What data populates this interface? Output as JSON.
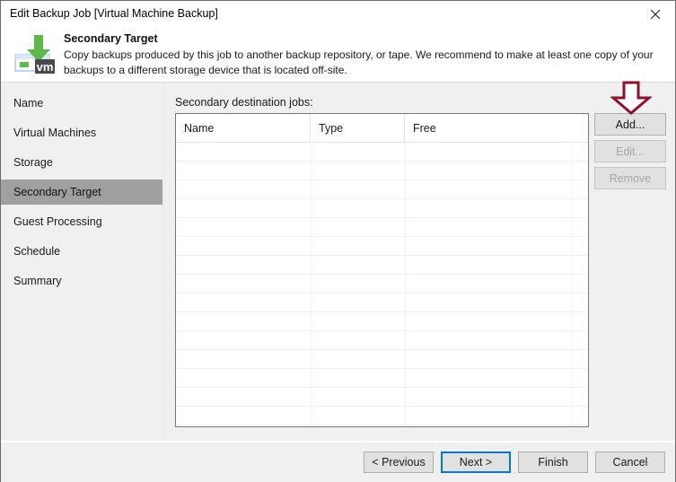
{
  "window": {
    "title": "Edit Backup Job [Virtual Machine Backup]",
    "close_icon": "close-icon"
  },
  "header": {
    "icon": "vm-backup-download-icon",
    "title": "Secondary Target",
    "description": "Copy backups produced by this job to another backup repository, or tape. We recommend to make at least one copy of your backups to a different storage device that is located off-site."
  },
  "sidebar": {
    "items": [
      {
        "label": "Name",
        "selected": false
      },
      {
        "label": "Virtual Machines",
        "selected": false
      },
      {
        "label": "Storage",
        "selected": false
      },
      {
        "label": "Secondary Target",
        "selected": true
      },
      {
        "label": "Guest Processing",
        "selected": false
      },
      {
        "label": "Schedule",
        "selected": false
      },
      {
        "label": "Summary",
        "selected": false
      }
    ]
  },
  "main": {
    "grid_label": "Secondary destination jobs:",
    "grid": {
      "columns": [
        "Name",
        "Type",
        "Free"
      ],
      "rows": []
    },
    "side_buttons": [
      {
        "label": "Add...",
        "enabled": true
      },
      {
        "label": "Edit...",
        "enabled": false
      },
      {
        "label": "Remove",
        "enabled": false
      }
    ]
  },
  "annotation": {
    "arrow": "down-arrow-annotation",
    "color": "#8c1230"
  },
  "footer": {
    "buttons": [
      {
        "label": "< Previous",
        "default": false
      },
      {
        "label": "Next >",
        "default": true
      },
      {
        "label": "Finish",
        "default": false
      },
      {
        "label": "Cancel",
        "default": false
      }
    ]
  },
  "colors": {
    "selection": "#a0a0a0",
    "panel": "#f0f0f0",
    "focus": "#0078d7",
    "annotation": "#8c1230",
    "icon_green": "#5fb84b"
  }
}
